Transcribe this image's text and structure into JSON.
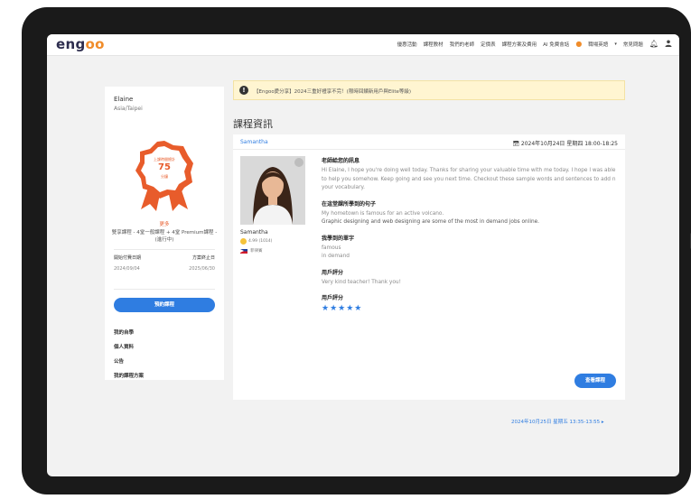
{
  "brand": {
    "logo_prefix": "eng",
    "logo_suffix": "oo"
  },
  "nav": {
    "items": [
      "優惠活動",
      "課程教材",
      "我們的老師",
      "定價表",
      "課程方案及費用",
      "AI 免費會話",
      "職場英語",
      "常見問題"
    ],
    "icons": [
      "bell-icon",
      "user-icon"
    ]
  },
  "sidebar": {
    "name": "Elaine",
    "timezone": "Asia/Taipei",
    "badge": {
      "caption": "上課時間總計",
      "value": "75",
      "unit": "分鐘"
    },
    "link": "更多",
    "course": "雙享課程 - 4堂一般課程 + 4堂 Premium課程 - (進行中)",
    "dates": {
      "start_label": "開始付費日期",
      "end_label": "方案終止日",
      "start_value": "2024/09/04",
      "end_value": "2025/06/30"
    },
    "book_button": "預約課程",
    "menu": [
      "我的自學",
      "個人資料",
      "公告",
      "我的課程方案"
    ]
  },
  "notice": {
    "icon": "!",
    "text": "【Engoo愛分享】2024三重好禮享不完！(限時回饋新用戶與Elite等級)"
  },
  "section_title": "課程資訊",
  "lesson": {
    "tutor": "Samantha",
    "calendar_icon": "calendar-icon",
    "datetime": "2024年10月24日 星期四 18:00-18:25",
    "rating": "4.99 (1014)",
    "country": "菲律賓",
    "blocks": [
      {
        "title": "老師給您的訊息",
        "body": "Hi Elaine, I hope you're doing well today. Thanks for sharing your valuable time with me today. I hope I was able to help you somehow. Keep going and see you next time. Checkout these sample words and sentences to add n your vocabulary."
      },
      {
        "title": "在這堂課所學到的句子",
        "line1": "My hometown is famous for an active volcano.",
        "line2": "Graphic designing and web designing are some of the most in demand jobs online."
      },
      {
        "title": "我學到的單字",
        "line1": "famous",
        "line2": "in demand"
      },
      {
        "title": "用戶評分",
        "body": "Very kind teacher! Thank you!"
      },
      {
        "title": "用戶評分",
        "stars": "★★★★★"
      }
    ],
    "review_button": "查看課程"
  },
  "next_lesson": "2024年10月25日 星期五 13:35-13:55 ▸",
  "colors": {
    "accent": "#2f7de1",
    "brand_orange": "#f08c2a",
    "badge_red": "#e85c2b",
    "notice_bg": "#fff5d1"
  }
}
